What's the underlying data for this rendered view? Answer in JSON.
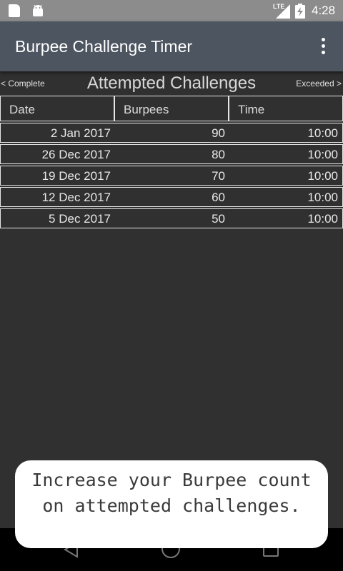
{
  "status_bar": {
    "network_label": "LTE",
    "clock": "4:28",
    "icons": [
      "sd-card-icon",
      "android-icon",
      "signal-icon",
      "battery-icon"
    ]
  },
  "app_bar": {
    "title": "Burpee Challenge Timer",
    "menu_icon": "more-vert-icon"
  },
  "pager": {
    "prev_label": "< Complete",
    "heading": "Attempted Challenges",
    "next_label": "Exceeded >"
  },
  "table": {
    "columns": [
      "Date",
      "Burpees",
      "Time"
    ],
    "rows": [
      [
        "2 Jan 2017",
        "90",
        "10:00"
      ],
      [
        "26 Dec 2017",
        "80",
        "10:00"
      ],
      [
        "19 Dec 2017",
        "70",
        "10:00"
      ],
      [
        "12 Dec 2017",
        "60",
        "10:00"
      ],
      [
        "5 Dec 2017",
        "50",
        "10:00"
      ]
    ]
  },
  "toast": {
    "message": "Increase your Burpee count on attempted challenges."
  },
  "colors": {
    "app_bar": "#4d5561",
    "background": "#303030",
    "status_bar": "#8c8c8c"
  }
}
